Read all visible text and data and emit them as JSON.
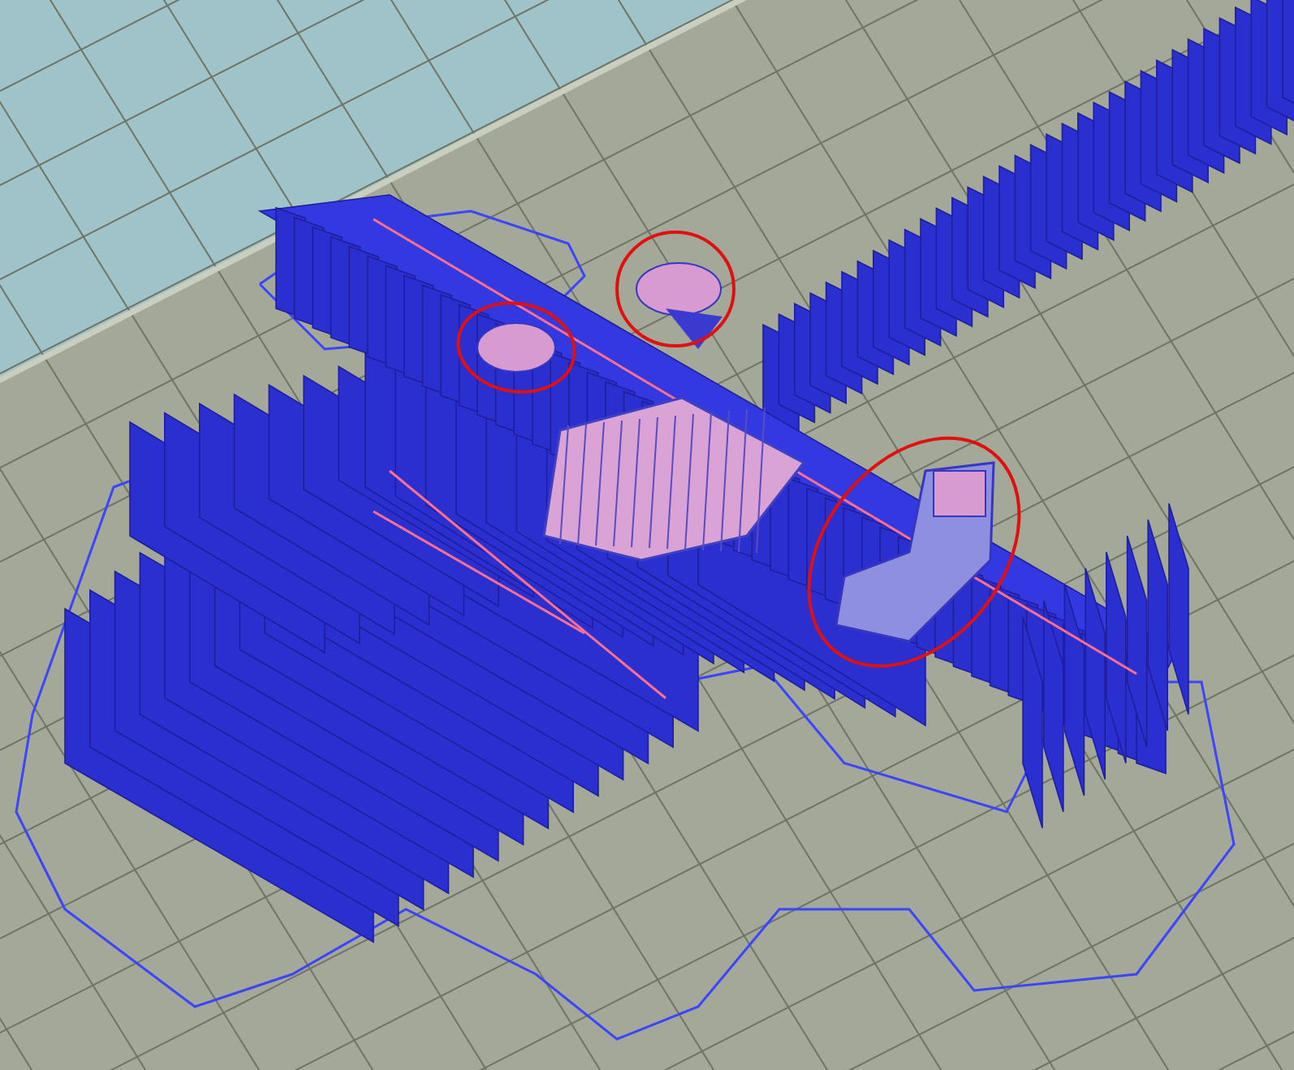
{
  "viewport": {
    "annotations": [
      {
        "kind": "ellipse"
      },
      {
        "kind": "ellipse"
      },
      {
        "kind": "ellipse"
      }
    ]
  }
}
